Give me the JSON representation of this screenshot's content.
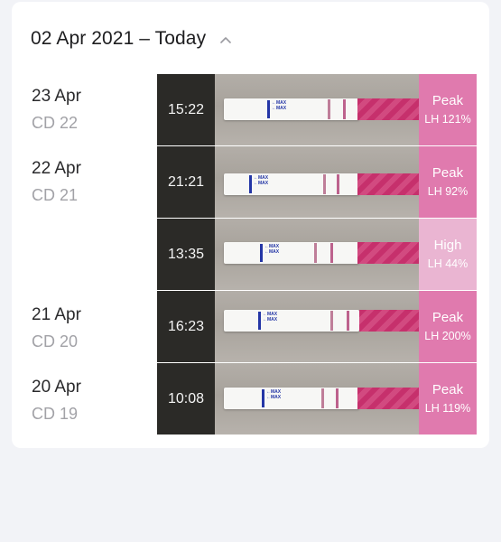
{
  "header": {
    "title": "02 Apr 2021 – Today"
  },
  "colors": {
    "peak": "#e07aae",
    "high": "#eab5d2"
  },
  "days": [
    {
      "date": "23 Apr",
      "cd": "CD 22"
    },
    {
      "date": "22 Apr",
      "cd": "CD 21"
    },
    {
      "date": "21 Apr",
      "cd": "CD 20"
    },
    {
      "date": "20 Apr",
      "cd": "CD 19"
    }
  ],
  "tests": [
    {
      "time": "15:22",
      "level": "Peak",
      "lh": "LH 121%",
      "color": "#e07aae"
    },
    {
      "time": "21:21",
      "level": "Peak",
      "lh": "LH 92%",
      "color": "#e07aae"
    },
    {
      "time": "13:35",
      "level": "High",
      "lh": "LH 44%",
      "color": "#eab5d2"
    },
    {
      "time": "16:23",
      "level": "Peak",
      "lh": "LH 200%",
      "color": "#e07aae"
    },
    {
      "time": "10:08",
      "level": "Peak",
      "lh": "LH 119%",
      "color": "#e07aae"
    }
  ]
}
